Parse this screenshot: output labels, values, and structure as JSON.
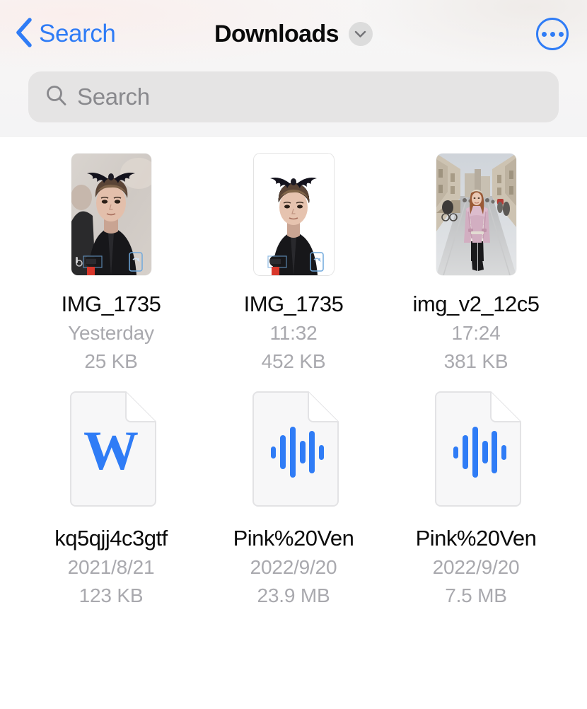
{
  "navbar": {
    "back_label": "Search",
    "back_icon": "chevron-left-icon",
    "title": "Downloads",
    "title_chevron_icon": "chevron-down-icon",
    "more_icon": "ellipsis-circle-icon",
    "accent_color": "#2f7cf6"
  },
  "search": {
    "placeholder": "Search",
    "value": "",
    "icon": "search-icon"
  },
  "files": [
    {
      "name": "IMG_1735",
      "date": "Yesterday",
      "size": "25 KB",
      "kind": "photo",
      "thumb": "photo-portrait-bat-wings"
    },
    {
      "name": "IMG_1735",
      "date": "11:32",
      "size": "452 KB",
      "kind": "photo",
      "thumb": "photo-portrait-bat-wings-white-bg"
    },
    {
      "name": "img_v2_12c5",
      "date": "17:24",
      "size": "381 KB",
      "kind": "photo",
      "thumb": "photo-woman-pink-coat-street"
    },
    {
      "name": "kq5qjj4c3gtf",
      "date": "2021/8/21",
      "size": "123 KB",
      "kind": "document",
      "thumb": "word-document-icon"
    },
    {
      "name": "Pink%20Ven",
      "date": "2022/9/20",
      "size": "23.9 MB",
      "kind": "audio",
      "thumb": "audio-waveform-icon"
    },
    {
      "name": "Pink%20Ven",
      "date": "2022/9/20",
      "size": "7.5 MB",
      "kind": "audio",
      "thumb": "audio-waveform-icon"
    }
  ]
}
